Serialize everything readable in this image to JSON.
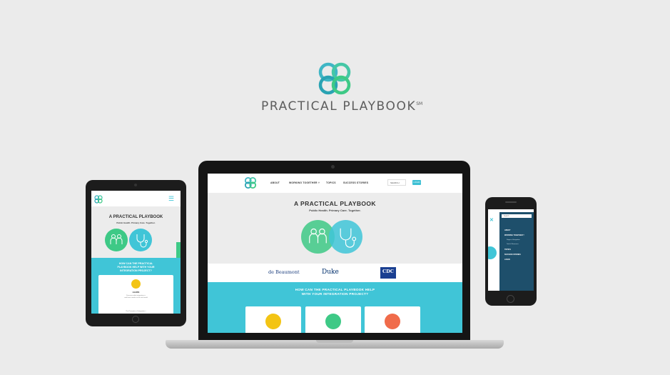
{
  "brand": {
    "name": "PRACTICAL PLAYBOOK",
    "mark": "SM"
  },
  "colors": {
    "teal": "#40c5d7",
    "green": "#3ec986",
    "gray_text": "#5d5d5d",
    "navy_menu": "#1e4f6b"
  },
  "icons": [
    "interlocking-rings-logo-icon",
    "people-icon",
    "stethoscope-icon",
    "handshake-icon",
    "tools-icon",
    "award-icon",
    "hamburger-menu-icon",
    "close-icon",
    "search-icon"
  ],
  "laptop_site": {
    "nav": [
      "ABOUT",
      "WORKING TOGETHER ˅",
      "TOPICS",
      "SUCCESS STORIES"
    ],
    "search_placeholder": "SEARCH",
    "login": "LOGIN",
    "hero_title": "A PRACTICAL PLAYBOOK",
    "hero_subtitle": "Public Health. Primary Care. Together.",
    "partners": [
      "de Beaumont",
      "Duke",
      "CDC"
    ],
    "help_title_line1": "HOW CAN THE PRACTICAL PLAYBOOK HELP",
    "help_title_line2": "WITH YOUR INTEGRATION PROJECT?"
  },
  "tablet_site": {
    "hero_title": "A PRACTICAL PLAYBOOK",
    "hero_subtitle": "Public Health. Primary Care. Together.",
    "help_title_line1": "HOW CAN THE PRACTICAL",
    "help_title_line2": "PLAYBOOK HELP WITH YOUR",
    "help_title_line3": "INTEGRATION PROJECT?",
    "card_heading": "LEARN",
    "card_text_line1": "Discover what integration is",
    "card_text_line2": "and how it works in the real world",
    "card_footer": "The Principles of Integration ›"
  },
  "phone_site": {
    "search_placeholder": "Search",
    "menu": [
      "ABOUT",
      "WORKING TOGETHER ˅",
      "TOPICS",
      "SUCCESS STORIES",
      "LOGIN"
    ],
    "submenu": [
      "Stages of Integration",
      "Tools & Resources"
    ]
  }
}
